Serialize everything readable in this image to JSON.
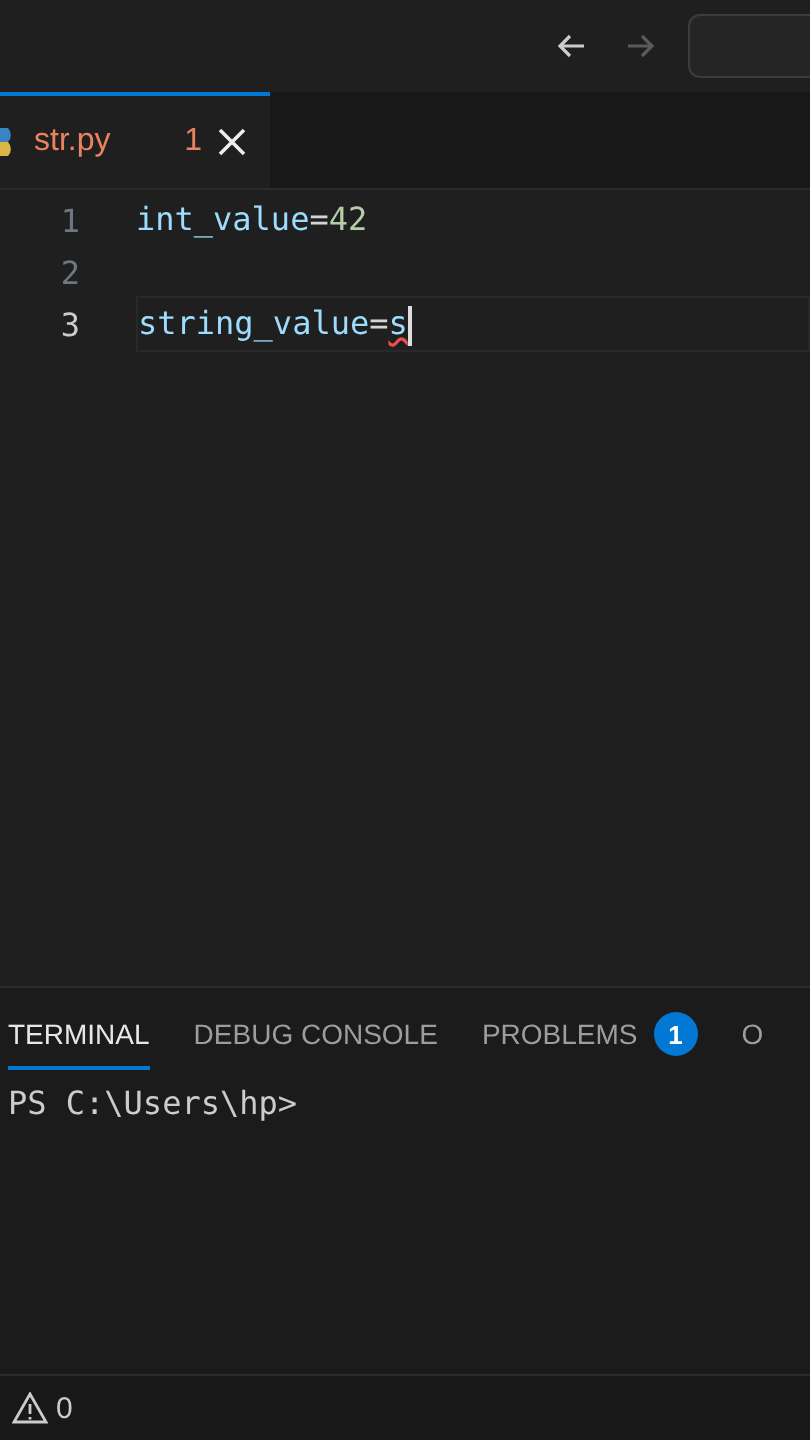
{
  "title_bar": {
    "back_enabled": true,
    "forward_enabled": false
  },
  "tabs": [
    {
      "label": "str.py",
      "problems": "1",
      "selected": true
    }
  ],
  "editor": {
    "lines": [
      {
        "number": "1",
        "current": false,
        "tokens": [
          {
            "kind": "var",
            "text": "int_value"
          },
          {
            "kind": "op",
            "text": "="
          },
          {
            "kind": "num",
            "text": "42"
          }
        ]
      },
      {
        "number": "2",
        "current": false
      },
      {
        "number": "3",
        "current": true,
        "cursor": true,
        "tokens": [
          {
            "kind": "var",
            "text": "string_value"
          },
          {
            "kind": "op",
            "text": "="
          },
          {
            "kind": "err",
            "text": "s"
          }
        ]
      }
    ]
  },
  "panel": {
    "tabs": [
      {
        "label": "TERMINAL",
        "selected": true
      },
      {
        "label": "DEBUG CONSOLE",
        "selected": false
      },
      {
        "label": "PROBLEMS",
        "badge": "1",
        "selected": false
      },
      {
        "label": "O",
        "selected": false
      }
    ],
    "terminal_lines": [
      "PS C:\\Users\\hp>"
    ]
  },
  "status_bar": {
    "warnings": "0"
  }
}
